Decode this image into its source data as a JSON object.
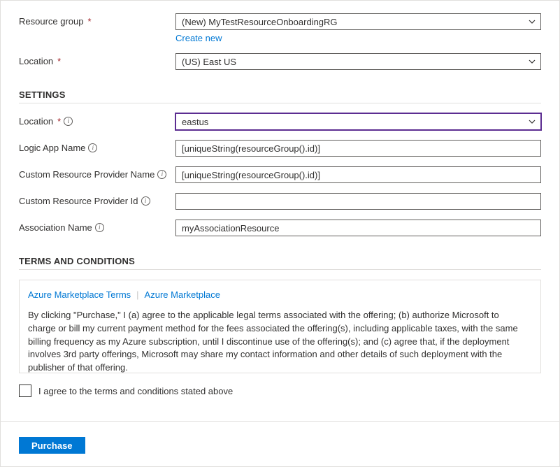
{
  "basics": {
    "resource_group": {
      "label": "Resource group",
      "value": "(New) MyTestResourceOnboardingRG",
      "create_new_link": "Create new"
    },
    "location": {
      "label": "Location",
      "value": "(US) East US"
    }
  },
  "settings": {
    "heading": "SETTINGS",
    "location": {
      "label": "Location",
      "value": "eastus"
    },
    "logic_app_name": {
      "label": "Logic App Name",
      "value": "[uniqueString(resourceGroup().id)]"
    },
    "custom_rp_name": {
      "label": "Custom Resource Provider Name",
      "value": "[uniqueString(resourceGroup().id)]"
    },
    "custom_rp_id": {
      "label": "Custom Resource Provider Id",
      "value": ""
    },
    "association_name": {
      "label": "Association Name",
      "value": "myAssociationResource"
    }
  },
  "terms": {
    "heading": "TERMS AND CONDITIONS",
    "link1": "Azure Marketplace Terms",
    "link2": "Azure Marketplace",
    "body": "By clicking \"Purchase,\" I (a) agree to the applicable legal terms associated with the offering; (b) authorize Microsoft to charge or bill my current payment method for the fees associated the offering(s), including applicable taxes, with the same billing frequency as my Azure subscription, until I discontinue use of the offering(s); and (c) agree that, if the deployment involves 3rd party offerings, Microsoft may share my contact information and other details of such deployment with the publisher of that offering.",
    "agree_label": "I agree to the terms and conditions stated above"
  },
  "actions": {
    "purchase": "Purchase"
  }
}
